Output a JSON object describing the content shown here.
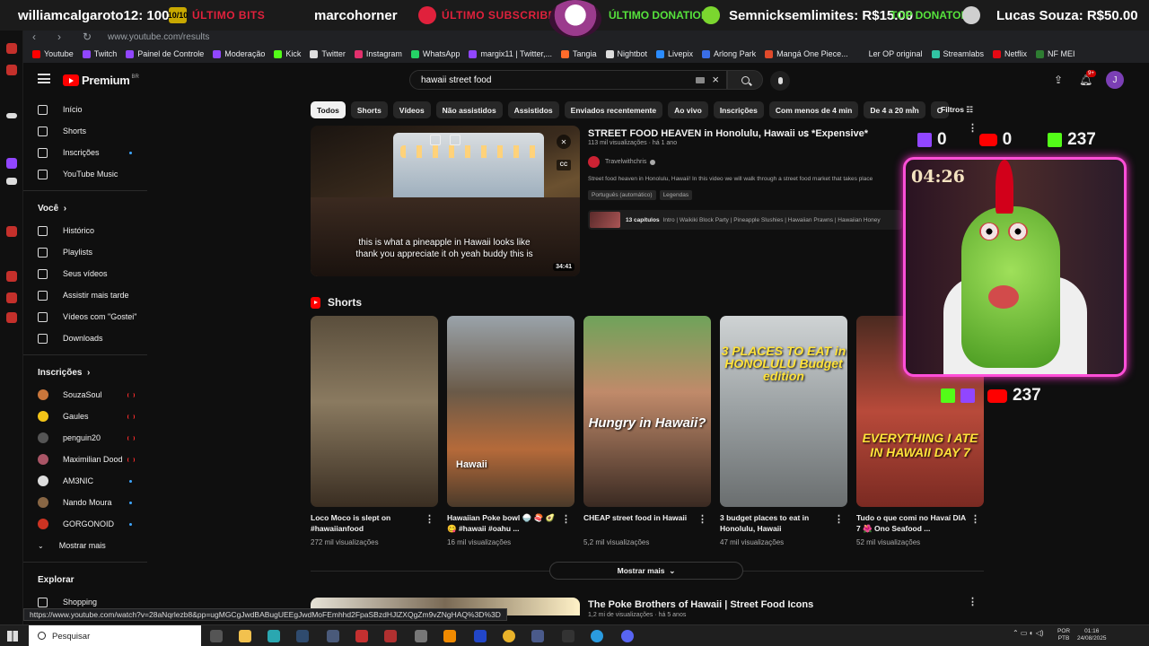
{
  "overlay": {
    "user_bits": "williamcalgaroto12: 100",
    "bits_badge": "10/10",
    "last_bits_label": "ÚLTIMO BITS",
    "subscriber_name": "marcohorner",
    "last_subscriber_label": "ÚLTIMO SUBSCRIBER",
    "last_donation_label": "ÚLTIMO DONATION",
    "donation": "Semnicksemlimites: R$15.00",
    "top_donator_label": "TOP DONATOR",
    "top_donator": "Lucas Souza: R$50.00",
    "twitch_count": "0",
    "youtube_count": "0",
    "kick_count": "237",
    "timer": "04:26",
    "youtube_count_2": "237"
  },
  "browser": {
    "url": "www.youtube.com/results",
    "bookmarks": [
      {
        "label": "Youtube",
        "color": "#ff0000"
      },
      {
        "label": "Twitch",
        "color": "#9146ff"
      },
      {
        "label": "Painel de Controle",
        "color": "#9146ff"
      },
      {
        "label": "Moderação",
        "color": "#9146ff"
      },
      {
        "label": "Kick",
        "color": "#53fc18"
      },
      {
        "label": "Twitter",
        "color": "#dddddd"
      },
      {
        "label": "Instagram",
        "color": "#e1306c"
      },
      {
        "label": "WhatsApp",
        "color": "#25d366"
      },
      {
        "label": "margix11 | Twitter,...",
        "color": "#9146ff"
      },
      {
        "label": "Tangia",
        "color": "#ff6b2b"
      },
      {
        "label": "Nightbot",
        "color": "#dddddd"
      },
      {
        "label": "Livepix",
        "color": "#2b8cff"
      },
      {
        "label": "Arlong Park",
        "color": "#3a6ee8"
      },
      {
        "label": "Mangá One Piece...",
        "color": "#e04a2b"
      },
      {
        "label": "Ler OP original",
        "color": "#202124"
      },
      {
        "label": "Streamlabs",
        "color": "#31c3a2"
      },
      {
        "label": "Netflix",
        "color": "#e50914"
      },
      {
        "label": "NF MEI",
        "color": "#2e7d32"
      }
    ],
    "status_url": "https://www.youtube.com/watch?v=28aNqrlezb8&pp=ugMGCgJwdBABugUEEgJwdMoFEmhhd2FpaSBzdHJlZXQgZm9vZNgHAQ%3D%3D"
  },
  "youtube": {
    "logo": "Premium",
    "logo_sup": "BR",
    "search_value": "hawaii street food",
    "notification_count": "9+",
    "avatar_letter": "J"
  },
  "sidebar": {
    "main": [
      {
        "label": "Início"
      },
      {
        "label": "Shorts"
      },
      {
        "label": "Inscrições"
      },
      {
        "label": "YouTube Music"
      }
    ],
    "you_header": "Você",
    "you": [
      {
        "label": "Histórico"
      },
      {
        "label": "Playlists"
      },
      {
        "label": "Seus vídeos"
      },
      {
        "label": "Assistir mais tarde"
      },
      {
        "label": "Vídeos com \"Gostei\""
      },
      {
        "label": "Downloads"
      }
    ],
    "subs_header": "Inscrições",
    "subs": [
      {
        "label": "SouzaSoul",
        "status": "live",
        "color": "#c9763b"
      },
      {
        "label": "Gaules",
        "status": "live",
        "color": "#f2c418"
      },
      {
        "label": "penguin20",
        "status": "live",
        "color": "#555555"
      },
      {
        "label": "Maximilian Dood",
        "status": "live",
        "color": "#aa5566"
      },
      {
        "label": "AM3NIC",
        "status": "new",
        "color": "#dddddd"
      },
      {
        "label": "Nando Moura",
        "status": "new",
        "color": "#886644"
      },
      {
        "label": "GORGONOID",
        "status": "new",
        "color": "#cc3322"
      }
    ],
    "show_more": "Mostrar mais",
    "explore_header": "Explorar",
    "explore": [
      {
        "label": "Shopping"
      }
    ]
  },
  "chips": [
    "Todos",
    "Shorts",
    "Vídeos",
    "Não assistidos",
    "Assistidos",
    "Enviados recentemente",
    "Ao vivo",
    "Inscrições",
    "Com menos de 4 min",
    "De 4 a 20 min",
    "C"
  ],
  "filters_label": "Filtros",
  "top_video": {
    "title": "STREET FOOD HEAVEN in Honolulu, Hawaii ᴜꜱ *Expensive*",
    "meta": "113 mil visualizações · há 1 ano",
    "channel": "Travelwithchris",
    "description": "Street food heaven in Honolulu, Hawaii! In this video we will walk through a street food market that takes place",
    "badge_1": "Português (automático)",
    "badge_2": "Legendas",
    "chapters_label": "13 capítulos",
    "chapters_text": "Intro | Waikiki Block Party | Pineapple Slushies | Hawaiian Prawns | Hawaiian Honey",
    "caption_1": "this is what a pineapple in Hawaii looks like",
    "caption_2": "thank you appreciate it oh yeah buddy this is",
    "duration": "34:41",
    "cc": "CC",
    "watched_fraction": 0.01
  },
  "shorts": {
    "header": "Shorts",
    "items": [
      {
        "title": "Loco Moco is slept on #hawaiianfood",
        "views": "272 mil visualizações",
        "overlay": ""
      },
      {
        "title": "Hawaiian Poke bowl 🍚 🍣 🥑 😋 #hawaii #oahu ...",
        "views": "16 mil visualizações",
        "overlay": "Hawaii"
      },
      {
        "title": "CHEAP street food in Hawaii",
        "views": "5,2 mil visualizações",
        "overlay": "Hungry in Hawaii?"
      },
      {
        "title": "3 budget places to eat in Honolulu, Hawaii",
        "views": "47 mil visualizações",
        "overlay": "3 PLACES TO EAT in HONOLULU Budget edition"
      },
      {
        "title": "Tudo o que comi no Havaí DIA 7 🌺 Ono Seafood ...",
        "views": "52 mil visualizações",
        "overlay": "EVERYTHING I ATE IN HAWAII DAY 7"
      }
    ],
    "show_more": "Mostrar mais"
  },
  "second_video": {
    "title": "The Poke Brothers of Hawaii | Street Food Icons",
    "meta": "1,2 mi de visualizações · há 5 anos"
  },
  "taskbar": {
    "search_label": "Pesquisar",
    "lang_1": "POR",
    "lang_2": "PTB",
    "time": "01:16",
    "date": "24/08/2025"
  }
}
